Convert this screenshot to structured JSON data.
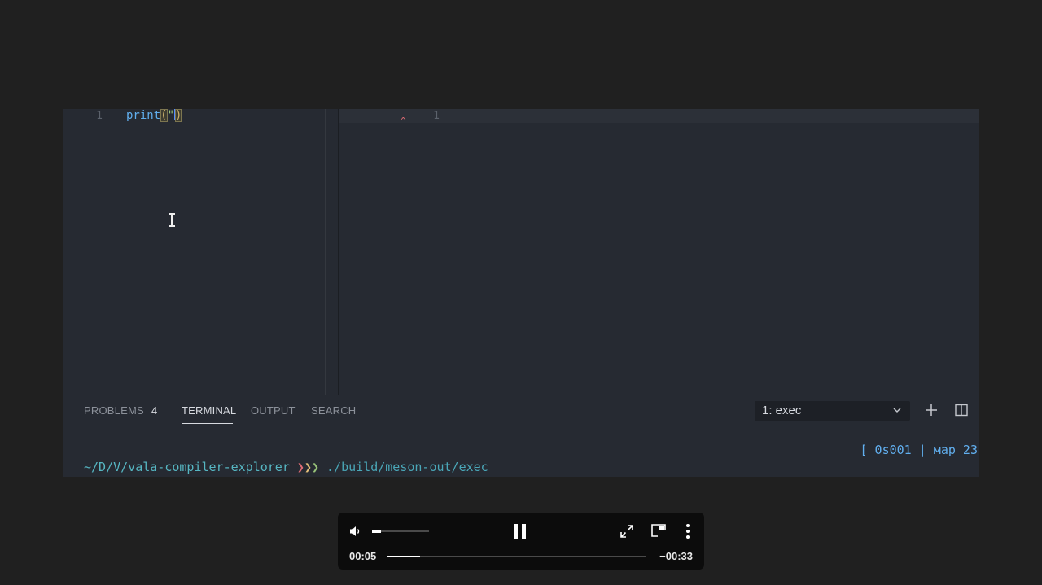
{
  "editor": {
    "left_pane": {
      "line_number": "1",
      "code_fn": "print",
      "code_open": "(",
      "code_quote": "\"",
      "code_close": ")"
    },
    "right_pane": {
      "line_number": "1",
      "error_marker": "^"
    }
  },
  "panel": {
    "tabs": [
      {
        "label": "PROBLEMS",
        "badge": "4"
      },
      {
        "label": "TERMINAL"
      },
      {
        "label": "OUTPUT"
      },
      {
        "label": "SEARCH"
      }
    ],
    "active_tab": "TERMINAL",
    "terminal_select": "1: exec",
    "terminal": {
      "status": "[ 0s001 | мар 23",
      "cwd": "~/D/V/vala-compiler-explorer",
      "arrows": [
        "❯",
        "❯",
        "❯"
      ],
      "command": "./build/meson-out/exec"
    }
  },
  "video": {
    "elapsed": "00:05",
    "remaining": "−00:33",
    "progress": 0.13,
    "volume": 0.15
  },
  "colors": {
    "background": "#202020",
    "editor_bg": "#262a32",
    "function": "#61afef",
    "bracket": "#c8ae6b",
    "error": "#e06c75",
    "terminal_cwd": "#56b6c2"
  }
}
